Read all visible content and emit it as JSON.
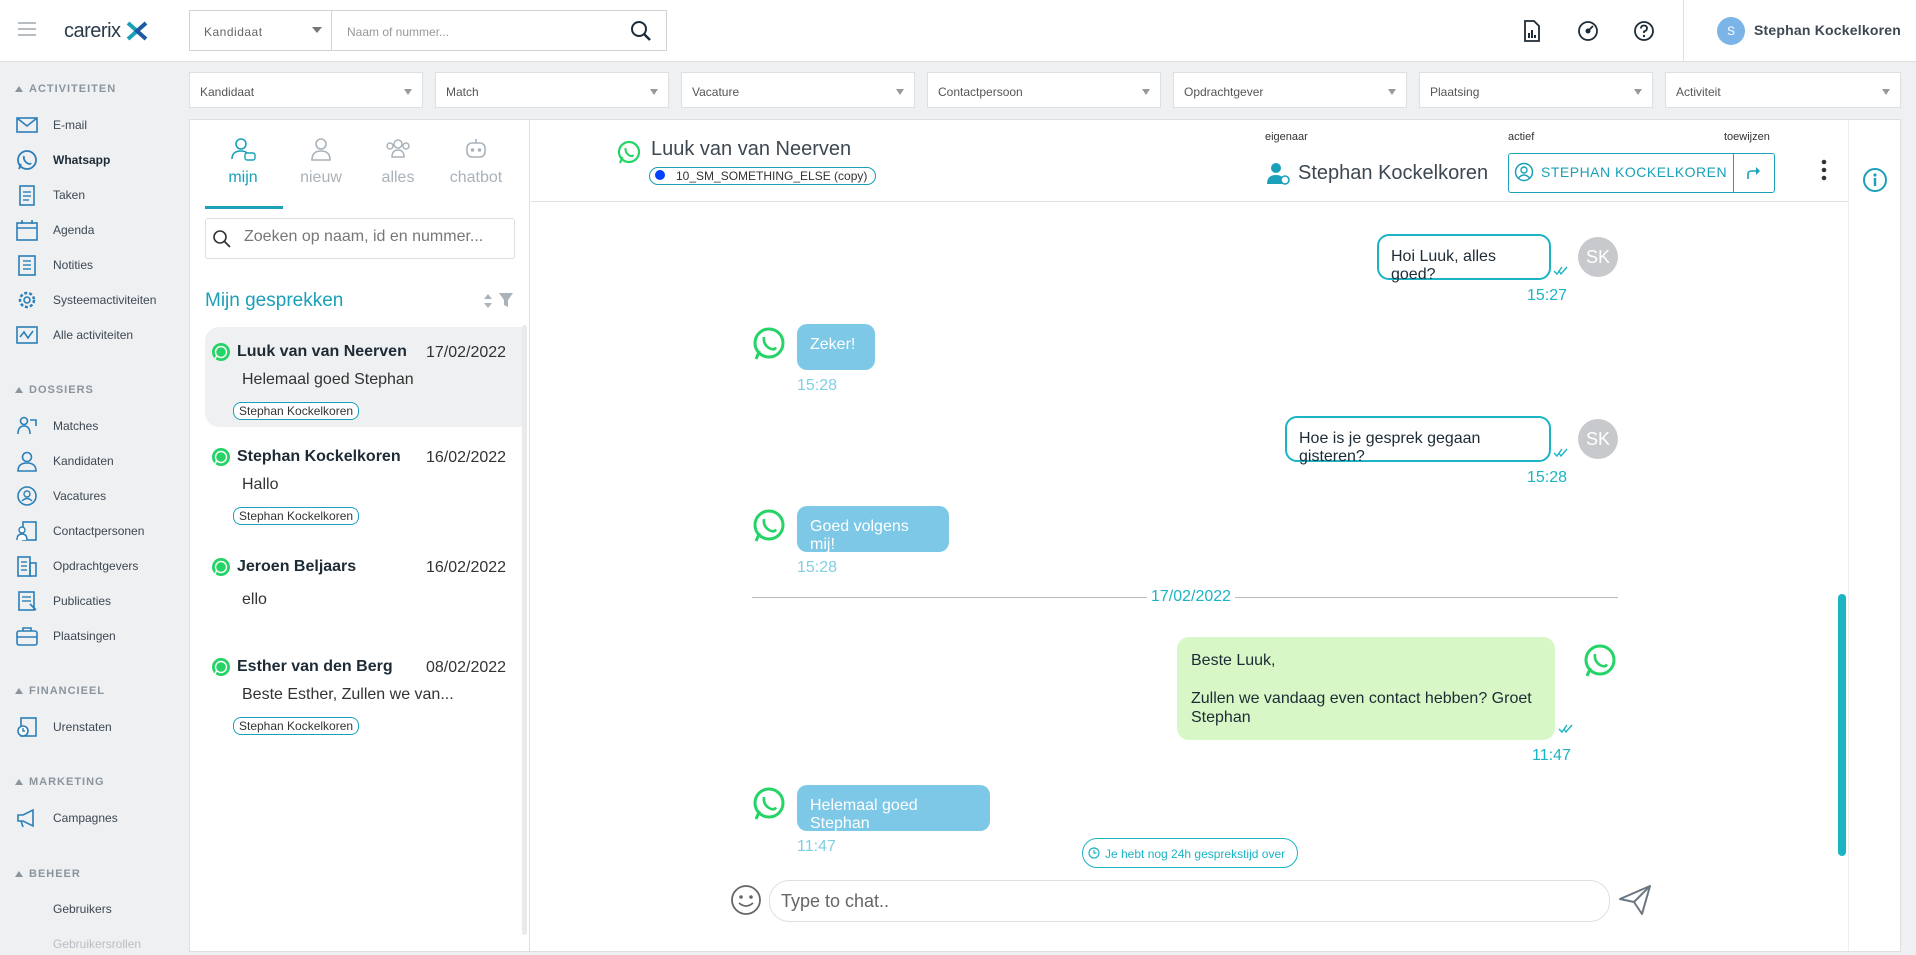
{
  "topbar": {
    "logo_text": "carerix",
    "search_type": "Kandidaat",
    "search_placeholder": "Naam of nummer...",
    "user_initial": "S",
    "user_name": "Stephan Kockelkoren"
  },
  "sidebar": {
    "sections": [
      {
        "title": "ACTIVITEITEN",
        "items": [
          "E-mail",
          "Whatsapp",
          "Taken",
          "Agenda",
          "Notities",
          "Systeemactiviteiten",
          "Alle activiteiten"
        ]
      },
      {
        "title": "DOSSIERS",
        "items": [
          "Matches",
          "Kandidaten",
          "Vacatures",
          "Contactpersonen",
          "Opdrachtgevers",
          "Publicaties",
          "Plaatsingen"
        ]
      },
      {
        "title": "FINANCIEEL",
        "items": [
          "Urenstaten"
        ]
      },
      {
        "title": "MARKETING",
        "items": [
          "Campagnes"
        ]
      },
      {
        "title": "BEHEER",
        "items": [
          "Gebruikers",
          "Gebruikersrollen"
        ]
      }
    ],
    "active_item": "Whatsapp"
  },
  "filters": [
    "Kandidaat",
    "Match",
    "Vacature",
    "Contactpersoon",
    "Opdrachtgever",
    "Plaatsing",
    "Activiteit"
  ],
  "conversations_panel": {
    "tabs": [
      {
        "label": "mijn",
        "active": true
      },
      {
        "label": "nieuw",
        "active": false
      },
      {
        "label": "alles",
        "active": false
      },
      {
        "label": "chatbot",
        "active": false
      }
    ],
    "search_placeholder": "Zoeken op naam, id en nummer...",
    "title": "Mijn gesprekken",
    "items": [
      {
        "name": "Luuk van van Neerven",
        "date": "17/02/2022",
        "message": "Helemaal goed Stephan",
        "tag": "Stephan Kockelkoren",
        "selected": true
      },
      {
        "name": "Stephan Kockelkoren",
        "date": "16/02/2022",
        "message": "Hallo",
        "tag": "Stephan Kockelkoren",
        "selected": false
      },
      {
        "name": "Jeroen Beljaars",
        "date": "16/02/2022",
        "message": "ello",
        "tag": "",
        "selected": false
      },
      {
        "name": "Esther van den Berg",
        "date": "08/02/2022",
        "message": "Beste Esther, Zullen we van...",
        "tag": "Stephan Kockelkoren",
        "selected": false
      }
    ]
  },
  "chat": {
    "contact_name": "Luuk van van Neerven",
    "contact_tag": "10_SM_SOMETHING_ELSE (copy)",
    "owner_label": "eigenaar",
    "owner_name": "Stephan Kockelkoren",
    "active_label": "actief",
    "assign_label": "toewijzen",
    "assigned_to": "STEPHAN KOCKELKOREN",
    "messages": [
      {
        "direction": "out",
        "text": "Hoi Luuk, alles goed?",
        "time": "15:27",
        "avatar": "SK"
      },
      {
        "direction": "in",
        "text": "Zeker!",
        "time": "15:28"
      },
      {
        "direction": "out",
        "text": "Hoe is je gesprek gegaan gisteren?",
        "time": "15:28",
        "avatar": "SK"
      },
      {
        "direction": "in",
        "text": "Goed volgens mij!",
        "time": "15:28"
      },
      {
        "direction": "template",
        "greeting": "Beste Luuk,",
        "body": "Zullen we vandaag even contact hebben? Groet Stephan",
        "time": "11:47"
      },
      {
        "direction": "in",
        "text": "Helemaal goed Stephan",
        "time": "11:47"
      }
    ],
    "date_divider": "17/02/2022",
    "time_left_notice": "Je hebt nog 24h gesprekstijd over",
    "input_placeholder": "Type to chat.."
  },
  "colors": {
    "accent": "#1aa0b8",
    "whatsapp": "#25d366",
    "incoming": "#7cc8e6",
    "template": "#d7f7c6"
  }
}
